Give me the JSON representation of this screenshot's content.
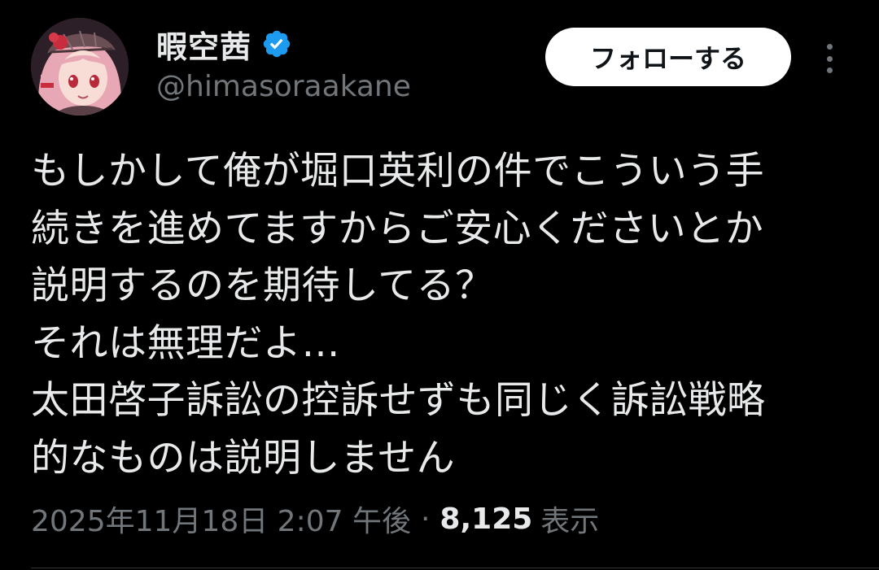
{
  "author": {
    "display_name": "暇空茜",
    "handle": "@himasoraakane",
    "verified": true,
    "avatar_icon": "anime-girl-avatar"
  },
  "actions": {
    "follow_label": "フォローする",
    "more_icon": "more-vertical-icon"
  },
  "tweet": {
    "lines": [
      "もしかして俺が堀口英利の件でこういう手",
      "続きを進めてますからご安心くださいとか",
      "説明するのを期待してる？",
      "それは無理だよ…",
      "太田啓子訴訟の控訴せずも同じく訴訟戦略",
      "的なものは説明しません"
    ]
  },
  "meta": {
    "timestamp": "2025年11月18日 2:07 午後",
    "separator": "·",
    "views_count": "8,125",
    "views_label": "表示"
  },
  "colors": {
    "background": "#000000",
    "text": "#e7e9ea",
    "secondary": "#71767b",
    "verified": "#1d9bf0",
    "button_bg": "#ffffff"
  }
}
